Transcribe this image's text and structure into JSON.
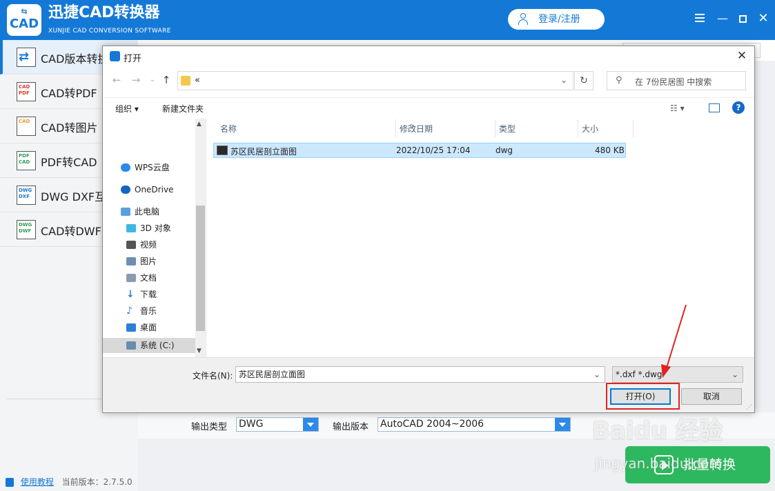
{
  "app": {
    "logo_text": "CAD",
    "title": "迅捷CAD转换器",
    "subtitle": "XUNJIE CAD CONVERSION SOFTWARE",
    "login_label": "登录/注册"
  },
  "sidebar": {
    "items": [
      {
        "label": "CAD版本转换",
        "icon": "cad-version-icon",
        "icon_text": "",
        "active": true
      },
      {
        "label": "CAD转PDF",
        "icon": "cad-to-pdf-icon",
        "icon_text": "CAD PDF"
      },
      {
        "label": "CAD转图片",
        "icon": "cad-to-image-icon",
        "icon_text": "CAD"
      },
      {
        "label": "PDF转CAD",
        "icon": "pdf-to-cad-icon",
        "icon_text": "PDF CAD"
      },
      {
        "label": "DWG DXF互转",
        "icon": "dwg-dxf-icon",
        "icon_text": "DWG DXF"
      },
      {
        "label": "CAD转DWF",
        "icon": "cad-to-dwf-icon",
        "icon_text": "DWG DWF"
      }
    ],
    "tutorial_link": "使用教程",
    "version_text": "当前版本：2.7.5.0"
  },
  "main": {
    "output_type_label": "输出类型",
    "output_type_value": "DWG",
    "output_version_label": "输出版本",
    "output_version_value": "AutoCAD 2004~2006",
    "batch_button": "批量转换",
    "watermark": "Baidu 经验",
    "watermark_sub": "jingyan.baidu.com"
  },
  "dialog": {
    "title": "打开",
    "address_path": "«",
    "search_placeholder": "在 7份民居图 中搜索",
    "organize_label": "组织 ▾",
    "new_folder_label": "新建文件夹",
    "nav_items": [
      {
        "label": "WPS云盘",
        "icon": "cloud-icon",
        "color": "#2b8be6"
      },
      {
        "label": "OneDrive",
        "icon": "onedrive-icon",
        "color": "#1565c0"
      },
      {
        "label": "此电脑",
        "icon": "computer-icon",
        "color": "#5aa0e0"
      },
      {
        "label": "3D 对象",
        "icon": "3d-objects-icon",
        "color": "#3cb8e0"
      },
      {
        "label": "视频",
        "icon": "video-icon",
        "color": "#555555"
      },
      {
        "label": "图片",
        "icon": "pictures-icon",
        "color": "#6f8fb0"
      },
      {
        "label": "文档",
        "icon": "documents-icon",
        "color": "#8a9bb0"
      },
      {
        "label": "下载",
        "icon": "download-icon",
        "color": "#2b7fd6"
      },
      {
        "label": "音乐",
        "icon": "music-icon",
        "color": "#2b7fd6"
      },
      {
        "label": "桌面",
        "icon": "desktop-icon",
        "color": "#2b7fd6"
      },
      {
        "label": "系统 (C:)",
        "icon": "drive-icon",
        "color": "#6a8caf",
        "selected": true
      }
    ],
    "columns": [
      "名称",
      "修改日期",
      "类型",
      "大小"
    ],
    "files": [
      {
        "name": "苏区民居剖立面图",
        "modified": "2022/10/25 17:04",
        "type": "dwg",
        "size": "480 KB"
      }
    ],
    "filename_label": "文件名(N):",
    "filename_value": "苏区民居剖立面图",
    "filetype_value": "*.dxf *.dwg",
    "open_button": "打开(O)",
    "cancel_button": "取消"
  },
  "colors": {
    "brand_blue": "#1479d6",
    "batch_green": "#2db85f",
    "annotation_red": "#e0231f"
  }
}
